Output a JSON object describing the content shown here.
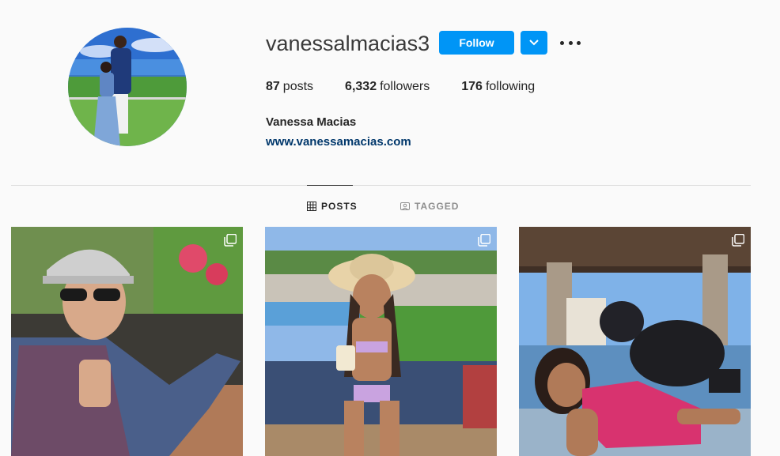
{
  "profile": {
    "username": "vanessalmacias3",
    "full_name": "Vanessa Macias",
    "website": "www.vanessamacias.com",
    "avatar_icon": "profile-photo"
  },
  "actions": {
    "follow_label": "Follow",
    "dropdown_icon": "chevron-down-icon",
    "more_icon": "more-options-icon"
  },
  "stats": [
    {
      "value": "87",
      "label": "posts"
    },
    {
      "value": "6,332",
      "label": "followers"
    },
    {
      "value": "176",
      "label": "following"
    }
  ],
  "tabs": [
    {
      "label": "POSTS",
      "icon": "grid-icon",
      "active": true
    },
    {
      "label": "TAGGED",
      "icon": "tagged-icon",
      "active": false
    }
  ],
  "posts": [
    {
      "description": "man-in-cap-and-sunglasses",
      "multi": true
    },
    {
      "description": "girl-in-sun-hat-by-pool",
      "multi": true
    },
    {
      "description": "girl-with-dog-on-patio",
      "multi": true
    }
  ],
  "colors": {
    "accent": "#0095f6",
    "link": "#00376b",
    "background": "#fafafa",
    "divider": "#dbdbdb"
  }
}
